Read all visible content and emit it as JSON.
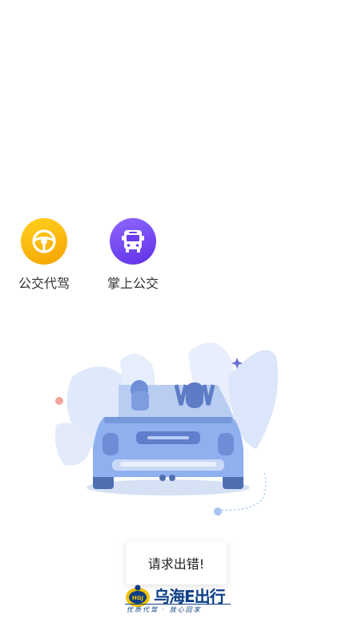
{
  "services": [
    {
      "label": "公交代驾",
      "icon": "steering-wheel-icon",
      "gradient": [
        "#ffcc1a",
        "#f7a600"
      ]
    },
    {
      "label": "掌上公交",
      "icon": "bus-icon",
      "gradient": [
        "#8a63ff",
        "#6234e8"
      ]
    }
  ],
  "toast": {
    "message": "请求出错!"
  },
  "brand": {
    "badge_text": "HGJ",
    "title": "乌海E出行",
    "tagline": "优质代驾 · 放心回家",
    "color": "#0d3f87"
  }
}
